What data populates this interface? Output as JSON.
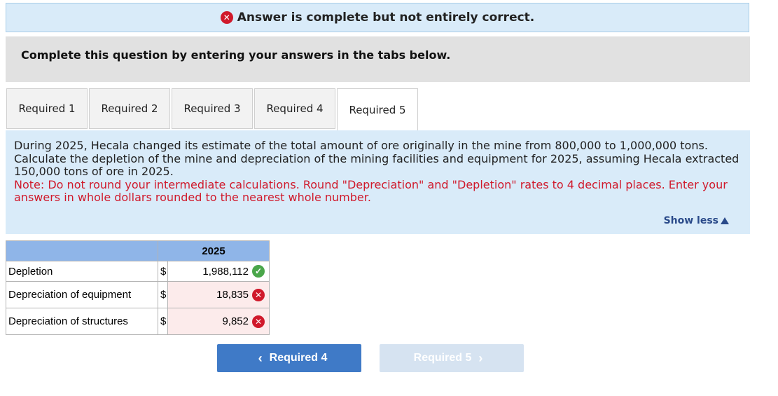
{
  "banner": {
    "text": "Answer is complete but not entirely correct."
  },
  "instructions": "Complete this question by entering your answers in the tabs below.",
  "tabs": [
    {
      "label": "Required 1"
    },
    {
      "label": "Required 2"
    },
    {
      "label": "Required 3"
    },
    {
      "label": "Required 4"
    },
    {
      "label": "Required 5"
    }
  ],
  "question": {
    "body": "During 2025, Hecala changed its estimate of the total amount of ore originally in the mine from 800,000 to 1,000,000 tons. Calculate the depletion of the mine and depreciation of the mining facilities and equipment for 2025, assuming Hecala extracted 150,000 tons of ore in 2025.",
    "note": "Note: Do not round your intermediate calculations. Round \"Depreciation\" and \"Depletion\" rates to 4 decimal places. Enter your answers in whole dollars rounded to the nearest whole number.",
    "show_less": "Show less"
  },
  "table": {
    "year_header": "2025",
    "rows": [
      {
        "label": "Depletion",
        "currency": "$",
        "value": "1,988,112",
        "status": "correct"
      },
      {
        "label": "Depreciation of equipment",
        "currency": "$",
        "value": "18,835",
        "status": "incorrect"
      },
      {
        "label": "Depreciation of structures",
        "currency": "$",
        "value": "9,852",
        "status": "incorrect"
      }
    ]
  },
  "nav": {
    "prev_label": "Required 4",
    "next_label": "Required 5"
  },
  "colors": {
    "banner_bg": "#d9ebf9",
    "error_red": "#d0192b",
    "correct_green": "#4aa64a",
    "button_blue": "#3f7ac7"
  }
}
